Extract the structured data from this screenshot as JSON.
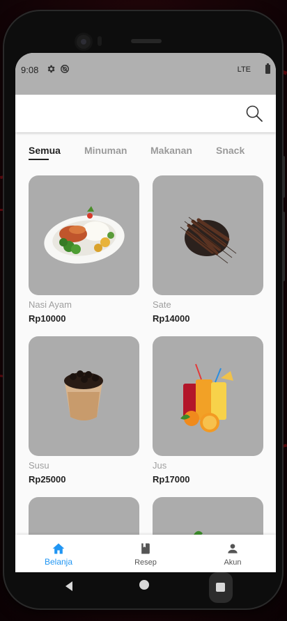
{
  "status_bar": {
    "time": "9:08",
    "network": "LTE",
    "icons": [
      "gear-icon",
      "sync-icon",
      "battery-icon"
    ]
  },
  "app_bar": {
    "search_icon": "search-icon"
  },
  "tabs": [
    {
      "label": "Semua",
      "active": true
    },
    {
      "label": "Minuman",
      "active": false
    },
    {
      "label": "Makanan",
      "active": false
    },
    {
      "label": "Snack",
      "active": false
    }
  ],
  "products": [
    {
      "name": "Nasi Ayam",
      "price": "Rp10000",
      "image": "rice-plate"
    },
    {
      "name": "Sate",
      "price": "Rp14000",
      "image": "satay-skewers"
    },
    {
      "name": "Susu",
      "price": "Rp25000",
      "image": "boba-milk"
    },
    {
      "name": "Jus",
      "price": "Rp17000",
      "image": "juice-glasses"
    },
    {
      "name": "",
      "price": "",
      "image": "partial"
    },
    {
      "name": "",
      "price": "",
      "image": "partial"
    }
  ],
  "bottom_nav": [
    {
      "label": "Belanja",
      "icon": "home-icon",
      "active": true
    },
    {
      "label": "Resep",
      "icon": "book-icon",
      "active": false
    },
    {
      "label": "Akun",
      "icon": "person-icon",
      "active": false
    }
  ],
  "colors": {
    "accent": "#2196f3",
    "card_bg": "#acacac",
    "status_bar": "#b0b0b0",
    "text_primary": "#222222",
    "text_secondary": "#9e9e9e"
  }
}
